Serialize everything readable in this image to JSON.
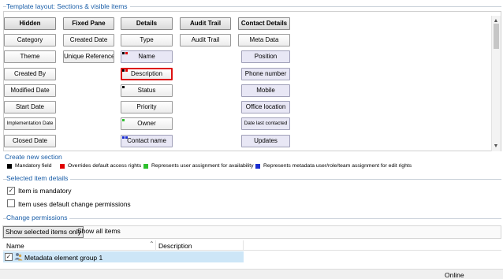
{
  "layout_section": {
    "title": "Template layout: Sections & visible items"
  },
  "columns": [
    {
      "header": "Hidden",
      "items": [
        {
          "label": "Category"
        },
        {
          "label": "Theme"
        },
        {
          "label": "Created By"
        },
        {
          "label": "Modified Date"
        },
        {
          "label": "Start Date"
        },
        {
          "label": "Implementation Date"
        },
        {
          "label": "Closed Date"
        }
      ]
    },
    {
      "header": "Fixed Pane",
      "items": [
        {
          "label": "Created Date"
        },
        {
          "label": "Unique Reference"
        }
      ]
    },
    {
      "header": "Details",
      "items": [
        {
          "label": "Type"
        },
        {
          "label": "Name"
        },
        {
          "label": "Description"
        },
        {
          "label": "Status"
        },
        {
          "label": "Priority"
        },
        {
          "label": "Owner"
        },
        {
          "label": "Contact name"
        }
      ]
    },
    {
      "header": "Audit Trail",
      "items": [
        {
          "label": "Audit Trail"
        }
      ]
    },
    {
      "header": "Contact Details",
      "items": [
        {
          "label": "Meta Data"
        },
        {
          "label": "Position"
        },
        {
          "label": "Phone number"
        },
        {
          "label": "Mobile"
        },
        {
          "label": "Office location"
        },
        {
          "label": "Date last contacted"
        },
        {
          "label": "Updates"
        }
      ]
    }
  ],
  "create_section_link": "Create new section",
  "legend": [
    {
      "color": "#000000",
      "label": "Mandatory field"
    },
    {
      "color": "#e00000",
      "label": "Overrides default access rights"
    },
    {
      "color": "#2ec02e",
      "label": "Represents user assignment for availability"
    },
    {
      "color": "#1a2ed0",
      "label": "Represents metadata user/role/team assignment for edit rights"
    }
  ],
  "selected_item_details": {
    "title": "Selected item details",
    "mandatory": {
      "label": "Item is mandatory",
      "checked": true
    },
    "default_permissions": {
      "label": "Item uses default change permissions",
      "checked": false
    }
  },
  "change_permissions": {
    "title": "Change permissions",
    "show_selected": "Show selected items only",
    "show_all": "Show all items",
    "col_name": "Name",
    "col_description": "Description",
    "rows": [
      {
        "name": "Metadata element group 1",
        "checked": true,
        "icon": "user-group-icon"
      }
    ]
  },
  "status": {
    "text": "Online"
  }
}
